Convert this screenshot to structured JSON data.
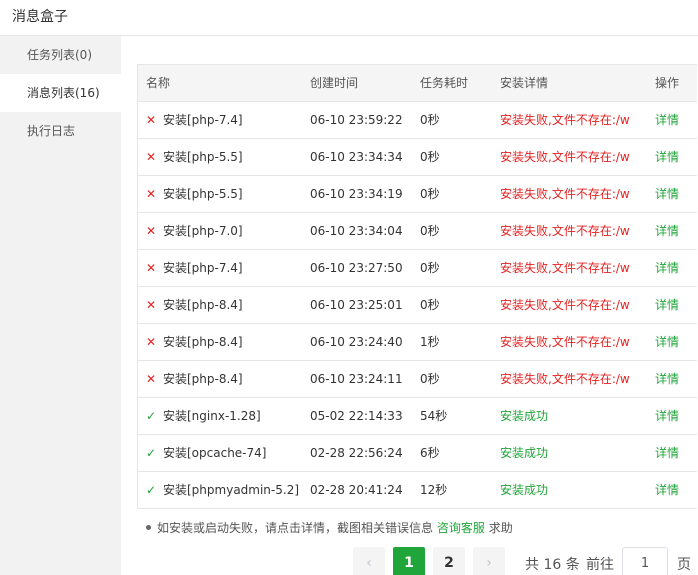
{
  "window": {
    "title": "消息盒子"
  },
  "sidebar": {
    "items": [
      {
        "label": "任务列表(0)"
      },
      {
        "label": "消息列表(16)"
      },
      {
        "label": "执行日志"
      }
    ]
  },
  "table": {
    "headers": {
      "name": "名称",
      "time": "创建时间",
      "cost": "任务耗时",
      "detail": "安装详情",
      "op": "操作"
    },
    "rows": [
      {
        "status": "fail",
        "name": "安装[php-7.4]",
        "time": "06-10 23:59:22",
        "cost": "0秒",
        "detail": "安装失败,文件不存在:/w",
        "op": "详情"
      },
      {
        "status": "fail",
        "name": "安装[php-5.5]",
        "time": "06-10 23:34:34",
        "cost": "0秒",
        "detail": "安装失败,文件不存在:/w",
        "op": "详情"
      },
      {
        "status": "fail",
        "name": "安装[php-5.5]",
        "time": "06-10 23:34:19",
        "cost": "0秒",
        "detail": "安装失败,文件不存在:/w",
        "op": "详情"
      },
      {
        "status": "fail",
        "name": "安装[php-7.0]",
        "time": "06-10 23:34:04",
        "cost": "0秒",
        "detail": "安装失败,文件不存在:/w",
        "op": "详情"
      },
      {
        "status": "fail",
        "name": "安装[php-7.4]",
        "time": "06-10 23:27:50",
        "cost": "0秒",
        "detail": "安装失败,文件不存在:/w",
        "op": "详情"
      },
      {
        "status": "fail",
        "name": "安装[php-8.4]",
        "time": "06-10 23:25:01",
        "cost": "0秒",
        "detail": "安装失败,文件不存在:/w",
        "op": "详情"
      },
      {
        "status": "fail",
        "name": "安装[php-8.4]",
        "time": "06-10 23:24:40",
        "cost": "1秒",
        "detail": "安装失败,文件不存在:/w",
        "op": "详情"
      },
      {
        "status": "fail",
        "name": "安装[php-8.4]",
        "time": "06-10 23:24:11",
        "cost": "0秒",
        "detail": "安装失败,文件不存在:/w",
        "op": "详情"
      },
      {
        "status": "ok",
        "name": "安装[nginx-1.28]",
        "time": "05-02 22:14:33",
        "cost": "54秒",
        "detail": "安装成功",
        "op": "详情"
      },
      {
        "status": "ok",
        "name": "安装[opcache-74]",
        "time": "02-28 22:56:24",
        "cost": "6秒",
        "detail": "安装成功",
        "op": "详情"
      },
      {
        "status": "ok",
        "name": "安装[phpmyadmin-5.2]",
        "time": "02-28 20:41:24",
        "cost": "12秒",
        "detail": "安装成功",
        "op": "详情"
      }
    ]
  },
  "tip": {
    "text": "如安装或启动失败，请点击详情，截图相关错误信息",
    "link": "咨询客服",
    "suffix": "求助"
  },
  "pager": {
    "prev": "‹",
    "pages": [
      "1",
      "2"
    ],
    "current": "1",
    "next": "›",
    "total_text": "共 16 条",
    "goto_label": "前往",
    "goto_value": "1",
    "page_unit": "页"
  },
  "colors": {
    "accent": "#20a53a",
    "error": "#e52222"
  },
  "icons": {
    "fail": "close-icon",
    "ok": "check-icon"
  }
}
